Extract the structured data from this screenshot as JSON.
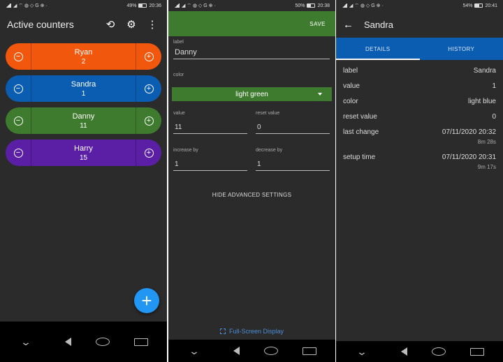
{
  "panel1": {
    "status": {
      "left": "◢ ⌔ ◍ ◇ G ⊕ ·",
      "battery": "49%",
      "time": "20:36"
    },
    "title": "Active counters",
    "icons": {
      "reset": "reset-icon",
      "settings": "gear-icon",
      "more": "more-vert-icon"
    },
    "counters": [
      {
        "name": "Ryan",
        "value": "2",
        "color": "#f1570d"
      },
      {
        "name": "Sandra",
        "value": "1",
        "color": "#0b5db1"
      },
      {
        "name": "Danny",
        "value": "11",
        "color": "#3f7b2f"
      },
      {
        "name": "Harry",
        "value": "15",
        "color": "#5b1fa6"
      }
    ],
    "minus": "−",
    "plus": "+",
    "fab": "+"
  },
  "panel2": {
    "status": {
      "left": "◢ ⌔ ◍ ◇ G ⊕ ·",
      "battery": "50%",
      "time": "20:38"
    },
    "save": "SAVE",
    "label_caption": "label",
    "label_value": "Danny",
    "color_caption": "color",
    "color_value": "light green",
    "value_caption": "value",
    "value_value": "11",
    "reset_caption": "reset value",
    "reset_value": "0",
    "increase_caption": "increase by",
    "increase_value": "1",
    "decrease_caption": "decrease by",
    "decrease_value": "1",
    "hide_advanced": "HIDE ADVANCED SETTINGS",
    "fullscreen": "Full-Screen Display"
  },
  "panel3": {
    "status": {
      "left": "◢ ⌔ ◍ ◇ G ⊕ ·",
      "battery": "54%",
      "time": "20:41"
    },
    "title": "Sandra",
    "tabs": [
      "DETAILS",
      "HISTORY"
    ],
    "rows": [
      {
        "k": "label",
        "v": "Sandra"
      },
      {
        "k": "value",
        "v": "1"
      },
      {
        "k": "color",
        "v": "light blue"
      },
      {
        "k": "reset value",
        "v": "0"
      }
    ],
    "last_change": {
      "k": "last change",
      "v": "07/11/2020 20:32",
      "sub": "8m 28s"
    },
    "setup_time": {
      "k": "setup time",
      "v": "07/11/2020 20:31",
      "sub": "9m 17s"
    }
  }
}
